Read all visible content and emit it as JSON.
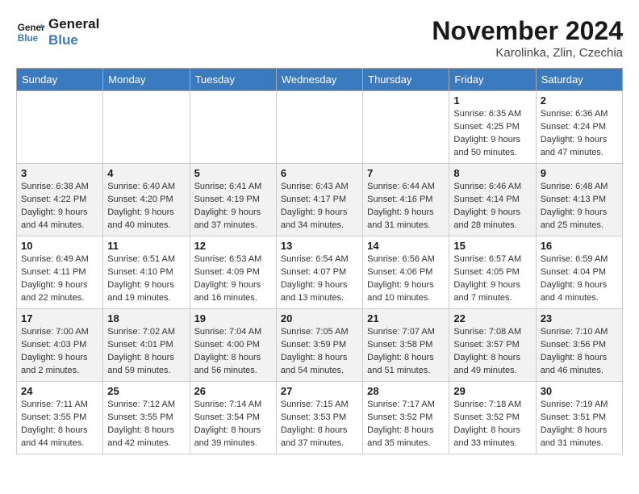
{
  "logo": {
    "text_general": "General",
    "text_blue": "Blue"
  },
  "header": {
    "month": "November 2024",
    "location": "Karolinka, Zlin, Czechia"
  },
  "days_of_week": [
    "Sunday",
    "Monday",
    "Tuesday",
    "Wednesday",
    "Thursday",
    "Friday",
    "Saturday"
  ],
  "weeks": [
    [
      {
        "day": "",
        "sunrise": "",
        "sunset": "",
        "daylight": ""
      },
      {
        "day": "",
        "sunrise": "",
        "sunset": "",
        "daylight": ""
      },
      {
        "day": "",
        "sunrise": "",
        "sunset": "",
        "daylight": ""
      },
      {
        "day": "",
        "sunrise": "",
        "sunset": "",
        "daylight": ""
      },
      {
        "day": "",
        "sunrise": "",
        "sunset": "",
        "daylight": ""
      },
      {
        "day": "1",
        "sunrise": "Sunrise: 6:35 AM",
        "sunset": "Sunset: 4:25 PM",
        "daylight": "Daylight: 9 hours and 50 minutes."
      },
      {
        "day": "2",
        "sunrise": "Sunrise: 6:36 AM",
        "sunset": "Sunset: 4:24 PM",
        "daylight": "Daylight: 9 hours and 47 minutes."
      }
    ],
    [
      {
        "day": "3",
        "sunrise": "Sunrise: 6:38 AM",
        "sunset": "Sunset: 4:22 PM",
        "daylight": "Daylight: 9 hours and 44 minutes."
      },
      {
        "day": "4",
        "sunrise": "Sunrise: 6:40 AM",
        "sunset": "Sunset: 4:20 PM",
        "daylight": "Daylight: 9 hours and 40 minutes."
      },
      {
        "day": "5",
        "sunrise": "Sunrise: 6:41 AM",
        "sunset": "Sunset: 4:19 PM",
        "daylight": "Daylight: 9 hours and 37 minutes."
      },
      {
        "day": "6",
        "sunrise": "Sunrise: 6:43 AM",
        "sunset": "Sunset: 4:17 PM",
        "daylight": "Daylight: 9 hours and 34 minutes."
      },
      {
        "day": "7",
        "sunrise": "Sunrise: 6:44 AM",
        "sunset": "Sunset: 4:16 PM",
        "daylight": "Daylight: 9 hours and 31 minutes."
      },
      {
        "day": "8",
        "sunrise": "Sunrise: 6:46 AM",
        "sunset": "Sunset: 4:14 PM",
        "daylight": "Daylight: 9 hours and 28 minutes."
      },
      {
        "day": "9",
        "sunrise": "Sunrise: 6:48 AM",
        "sunset": "Sunset: 4:13 PM",
        "daylight": "Daylight: 9 hours and 25 minutes."
      }
    ],
    [
      {
        "day": "10",
        "sunrise": "Sunrise: 6:49 AM",
        "sunset": "Sunset: 4:11 PM",
        "daylight": "Daylight: 9 hours and 22 minutes."
      },
      {
        "day": "11",
        "sunrise": "Sunrise: 6:51 AM",
        "sunset": "Sunset: 4:10 PM",
        "daylight": "Daylight: 9 hours and 19 minutes."
      },
      {
        "day": "12",
        "sunrise": "Sunrise: 6:53 AM",
        "sunset": "Sunset: 4:09 PM",
        "daylight": "Daylight: 9 hours and 16 minutes."
      },
      {
        "day": "13",
        "sunrise": "Sunrise: 6:54 AM",
        "sunset": "Sunset: 4:07 PM",
        "daylight": "Daylight: 9 hours and 13 minutes."
      },
      {
        "day": "14",
        "sunrise": "Sunrise: 6:56 AM",
        "sunset": "Sunset: 4:06 PM",
        "daylight": "Daylight: 9 hours and 10 minutes."
      },
      {
        "day": "15",
        "sunrise": "Sunrise: 6:57 AM",
        "sunset": "Sunset: 4:05 PM",
        "daylight": "Daylight: 9 hours and 7 minutes."
      },
      {
        "day": "16",
        "sunrise": "Sunrise: 6:59 AM",
        "sunset": "Sunset: 4:04 PM",
        "daylight": "Daylight: 9 hours and 4 minutes."
      }
    ],
    [
      {
        "day": "17",
        "sunrise": "Sunrise: 7:00 AM",
        "sunset": "Sunset: 4:03 PM",
        "daylight": "Daylight: 9 hours and 2 minutes."
      },
      {
        "day": "18",
        "sunrise": "Sunrise: 7:02 AM",
        "sunset": "Sunset: 4:01 PM",
        "daylight": "Daylight: 8 hours and 59 minutes."
      },
      {
        "day": "19",
        "sunrise": "Sunrise: 7:04 AM",
        "sunset": "Sunset: 4:00 PM",
        "daylight": "Daylight: 8 hours and 56 minutes."
      },
      {
        "day": "20",
        "sunrise": "Sunrise: 7:05 AM",
        "sunset": "Sunset: 3:59 PM",
        "daylight": "Daylight: 8 hours and 54 minutes."
      },
      {
        "day": "21",
        "sunrise": "Sunrise: 7:07 AM",
        "sunset": "Sunset: 3:58 PM",
        "daylight": "Daylight: 8 hours and 51 minutes."
      },
      {
        "day": "22",
        "sunrise": "Sunrise: 7:08 AM",
        "sunset": "Sunset: 3:57 PM",
        "daylight": "Daylight: 8 hours and 49 minutes."
      },
      {
        "day": "23",
        "sunrise": "Sunrise: 7:10 AM",
        "sunset": "Sunset: 3:56 PM",
        "daylight": "Daylight: 8 hours and 46 minutes."
      }
    ],
    [
      {
        "day": "24",
        "sunrise": "Sunrise: 7:11 AM",
        "sunset": "Sunset: 3:55 PM",
        "daylight": "Daylight: 8 hours and 44 minutes."
      },
      {
        "day": "25",
        "sunrise": "Sunrise: 7:12 AM",
        "sunset": "Sunset: 3:55 PM",
        "daylight": "Daylight: 8 hours and 42 minutes."
      },
      {
        "day": "26",
        "sunrise": "Sunrise: 7:14 AM",
        "sunset": "Sunset: 3:54 PM",
        "daylight": "Daylight: 8 hours and 39 minutes."
      },
      {
        "day": "27",
        "sunrise": "Sunrise: 7:15 AM",
        "sunset": "Sunset: 3:53 PM",
        "daylight": "Daylight: 8 hours and 37 minutes."
      },
      {
        "day": "28",
        "sunrise": "Sunrise: 7:17 AM",
        "sunset": "Sunset: 3:52 PM",
        "daylight": "Daylight: 8 hours and 35 minutes."
      },
      {
        "day": "29",
        "sunrise": "Sunrise: 7:18 AM",
        "sunset": "Sunset: 3:52 PM",
        "daylight": "Daylight: 8 hours and 33 minutes."
      },
      {
        "day": "30",
        "sunrise": "Sunrise: 7:19 AM",
        "sunset": "Sunset: 3:51 PM",
        "daylight": "Daylight: 8 hours and 31 minutes."
      }
    ]
  ]
}
